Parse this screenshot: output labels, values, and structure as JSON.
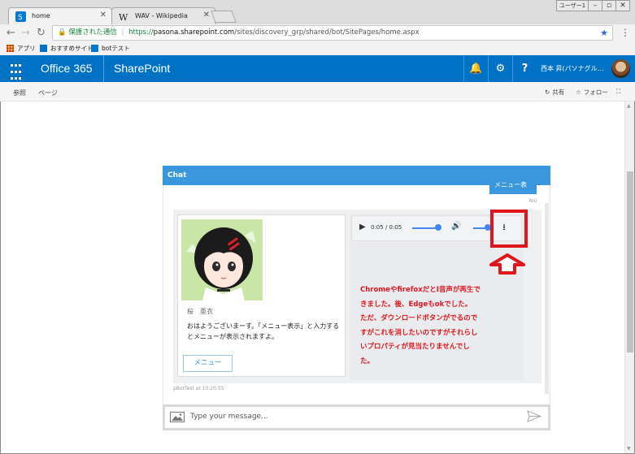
{
  "browser": {
    "tabs": [
      {
        "label": "home",
        "active": true
      },
      {
        "label": "WAV - Wikipedia",
        "active": false
      }
    ],
    "window_user": "ユーザー1",
    "omnibox": {
      "secure_label": "保護された通信",
      "url_scheme": "https://",
      "url_host": "pasona.sharepoint.com",
      "url_path": "/sites/discovery_grp/shared/bot/SitePages/home.aspx"
    },
    "bookmarks": [
      "アプリ",
      "おすすめサイト",
      "botテスト"
    ]
  },
  "suitebar": {
    "brand": "Office 365",
    "app": "SharePoint",
    "user_name": "西本 昇(パソナグル…",
    "colors": {
      "bar": "#0072c6"
    }
  },
  "commandbar": {
    "left": [
      "参照",
      "ページ"
    ],
    "share_label": "共有",
    "follow_label": "フォロー"
  },
  "chat": {
    "header_title": "Chat",
    "user_bubble_text": "メニュー表",
    "you_label": "You",
    "hero": {
      "name": "桜　亜衣",
      "text": "おはようございまーす。「メニュー表示」と入力するとメニューが表示されますよ。",
      "button_label": "メニュー"
    },
    "audio": {
      "time": "0:05 / 0:05"
    },
    "annotation_lines": [
      "ChromeやfirefoxだとI音声が再生で",
      "きました。後、Edgeもokでした。",
      "ただ、ダウンロードボタンがでるので",
      "すがこれを消したいのですがそれらし",
      "いプロパティが見当たりませんでし",
      "た。"
    ],
    "bot_meta": "pBotTest at 10:20:55",
    "input": {
      "placeholder": "Type your message..."
    },
    "colors": {
      "accent": "#3a96dd",
      "annotation": "#e0161d"
    }
  }
}
